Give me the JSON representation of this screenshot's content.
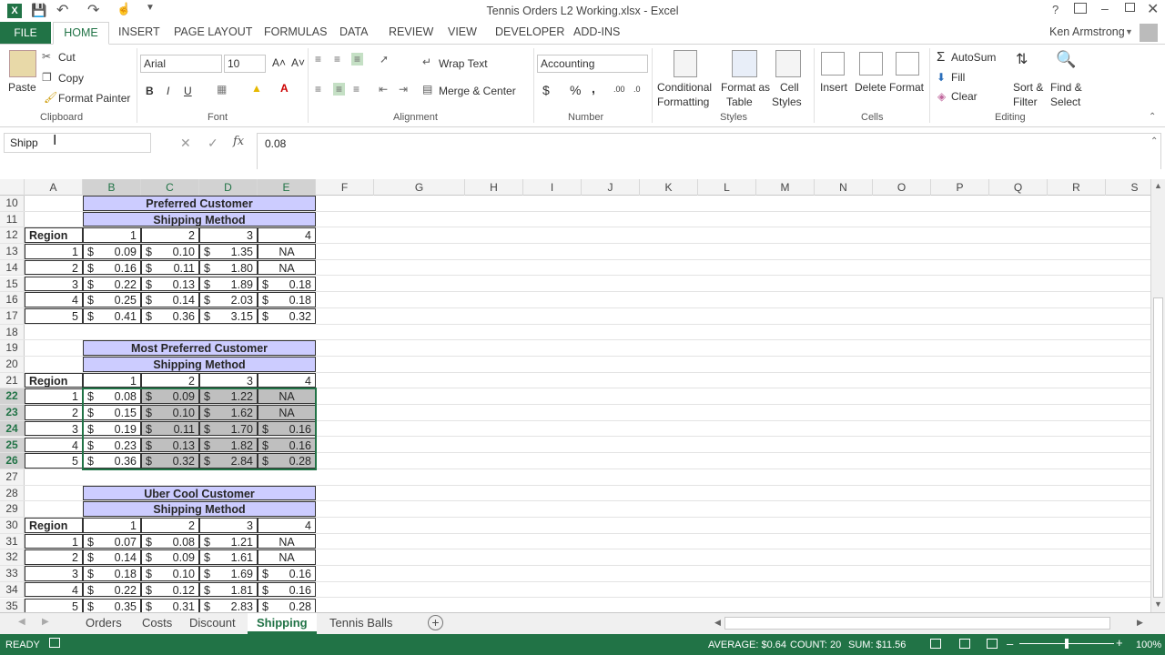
{
  "app": {
    "title": "Tennis Orders L2 Working.xlsx - Excel",
    "user": "Ken Armstrong"
  },
  "ribbon_tabs": [
    "FILE",
    "HOME",
    "INSERT",
    "PAGE LAYOUT",
    "FORMULAS",
    "DATA",
    "REVIEW",
    "VIEW",
    "DEVELOPER",
    "ADD-INS"
  ],
  "clipboard": {
    "paste": "Paste",
    "cut": "Cut",
    "copy": "Copy",
    "format_painter": "Format Painter",
    "label": "Clipboard"
  },
  "font": {
    "name": "Arial",
    "size": "10",
    "label": "Font",
    "bold": "B",
    "italic": "I",
    "underline": "U"
  },
  "alignment": {
    "wrap": "Wrap Text",
    "merge": "Merge & Center",
    "label": "Alignment"
  },
  "number": {
    "format": "Accounting",
    "dollar": "$",
    "percent": "%",
    "comma": ",",
    "label": "Number"
  },
  "styles": {
    "cond1": "Conditional",
    "cond2": "Formatting",
    "fmt1": "Format as",
    "fmt2": "Table",
    "cell1": "Cell",
    "cell2": "Styles",
    "label": "Styles"
  },
  "cells": {
    "insert": "Insert",
    "delete": "Delete",
    "format": "Format",
    "label": "Cells"
  },
  "editing": {
    "autosum": "AutoSum",
    "fill": "Fill",
    "clear": "Clear",
    "sort1": "Sort &",
    "sort2": "Filter",
    "find1": "Find &",
    "find2": "Select",
    "label": "Editing"
  },
  "formula": {
    "namebox": "Shipp",
    "value": "0.08",
    "fx": "fx"
  },
  "columns": [
    "A",
    "B",
    "C",
    "D",
    "E",
    "F",
    "G",
    "H",
    "I",
    "J",
    "K",
    "L",
    "M",
    "N",
    "O",
    "P",
    "Q",
    "R",
    "S"
  ],
  "rows": [
    {
      "n": "10",
      "type": "title",
      "text": "Preferred Customer"
    },
    {
      "n": "11",
      "type": "title",
      "text": "Shipping Method"
    },
    {
      "n": "12",
      "type": "head",
      "region": "Region",
      "vals": [
        "1",
        "2",
        "3",
        "4"
      ]
    },
    {
      "n": "13",
      "type": "data",
      "a": "1",
      "b": "0.09",
      "c": "0.10",
      "d": "1.35",
      "e": "NA"
    },
    {
      "n": "14",
      "type": "data",
      "a": "2",
      "b": "0.16",
      "c": "0.11",
      "d": "1.80",
      "e": "NA"
    },
    {
      "n": "15",
      "type": "data",
      "a": "3",
      "b": "0.22",
      "c": "0.13",
      "d": "1.89",
      "e": "0.18"
    },
    {
      "n": "16",
      "type": "data",
      "a": "4",
      "b": "0.25",
      "c": "0.14",
      "d": "2.03",
      "e": "0.18"
    },
    {
      "n": "17",
      "type": "data",
      "a": "5",
      "b": "0.41",
      "c": "0.36",
      "d": "3.15",
      "e": "0.32"
    },
    {
      "n": "18",
      "type": "blank"
    },
    {
      "n": "19",
      "type": "title",
      "text": "Most Preferred Customer"
    },
    {
      "n": "20",
      "type": "title",
      "text": "Shipping Method"
    },
    {
      "n": "21",
      "type": "head",
      "region": "Region",
      "vals": [
        "1",
        "2",
        "3",
        "4"
      ]
    },
    {
      "n": "22",
      "type": "data",
      "sel": true,
      "a": "1",
      "b": "0.08",
      "c": "0.09",
      "d": "1.22",
      "e": "NA"
    },
    {
      "n": "23",
      "type": "data",
      "sel": true,
      "a": "2",
      "b": "0.15",
      "c": "0.10",
      "d": "1.62",
      "e": "NA"
    },
    {
      "n": "24",
      "type": "data",
      "sel": true,
      "a": "3",
      "b": "0.19",
      "c": "0.11",
      "d": "1.70",
      "e": "0.16"
    },
    {
      "n": "25",
      "type": "data",
      "sel": true,
      "a": "4",
      "b": "0.23",
      "c": "0.13",
      "d": "1.82",
      "e": "0.16"
    },
    {
      "n": "26",
      "type": "data",
      "sel": true,
      "a": "5",
      "b": "0.36",
      "c": "0.32",
      "d": "2.84",
      "e": "0.28"
    },
    {
      "n": "27",
      "type": "blank"
    },
    {
      "n": "28",
      "type": "title",
      "text": "Uber Cool Customer"
    },
    {
      "n": "29",
      "type": "title",
      "text": "Shipping Method"
    },
    {
      "n": "30",
      "type": "head",
      "region": "Region",
      "vals": [
        "1",
        "2",
        "3",
        "4"
      ]
    },
    {
      "n": "31",
      "type": "data",
      "a": "1",
      "b": "0.07",
      "c": "0.08",
      "d": "1.21",
      "e": "NA"
    },
    {
      "n": "32",
      "type": "data",
      "a": "2",
      "b": "0.14",
      "c": "0.09",
      "d": "1.61",
      "e": "NA"
    },
    {
      "n": "33",
      "type": "data",
      "a": "3",
      "b": "0.18",
      "c": "0.10",
      "d": "1.69",
      "e": "0.16"
    },
    {
      "n": "34",
      "type": "data",
      "a": "4",
      "b": "0.22",
      "c": "0.12",
      "d": "1.81",
      "e": "0.16"
    },
    {
      "n": "35",
      "type": "data",
      "a": "5",
      "b": "0.35",
      "c": "0.31",
      "d": "2.83",
      "e": "0.28"
    }
  ],
  "sheet_tabs": [
    "Orders",
    "Costs",
    "Discount",
    "Shipping",
    "Tennis Balls"
  ],
  "active_sheet": "Shipping",
  "status": {
    "ready": "READY",
    "average": "AVERAGE: $0.64",
    "count": "COUNT: 20",
    "sum": "SUM: $11.56",
    "zoom": "100%"
  },
  "accent": "#217346"
}
